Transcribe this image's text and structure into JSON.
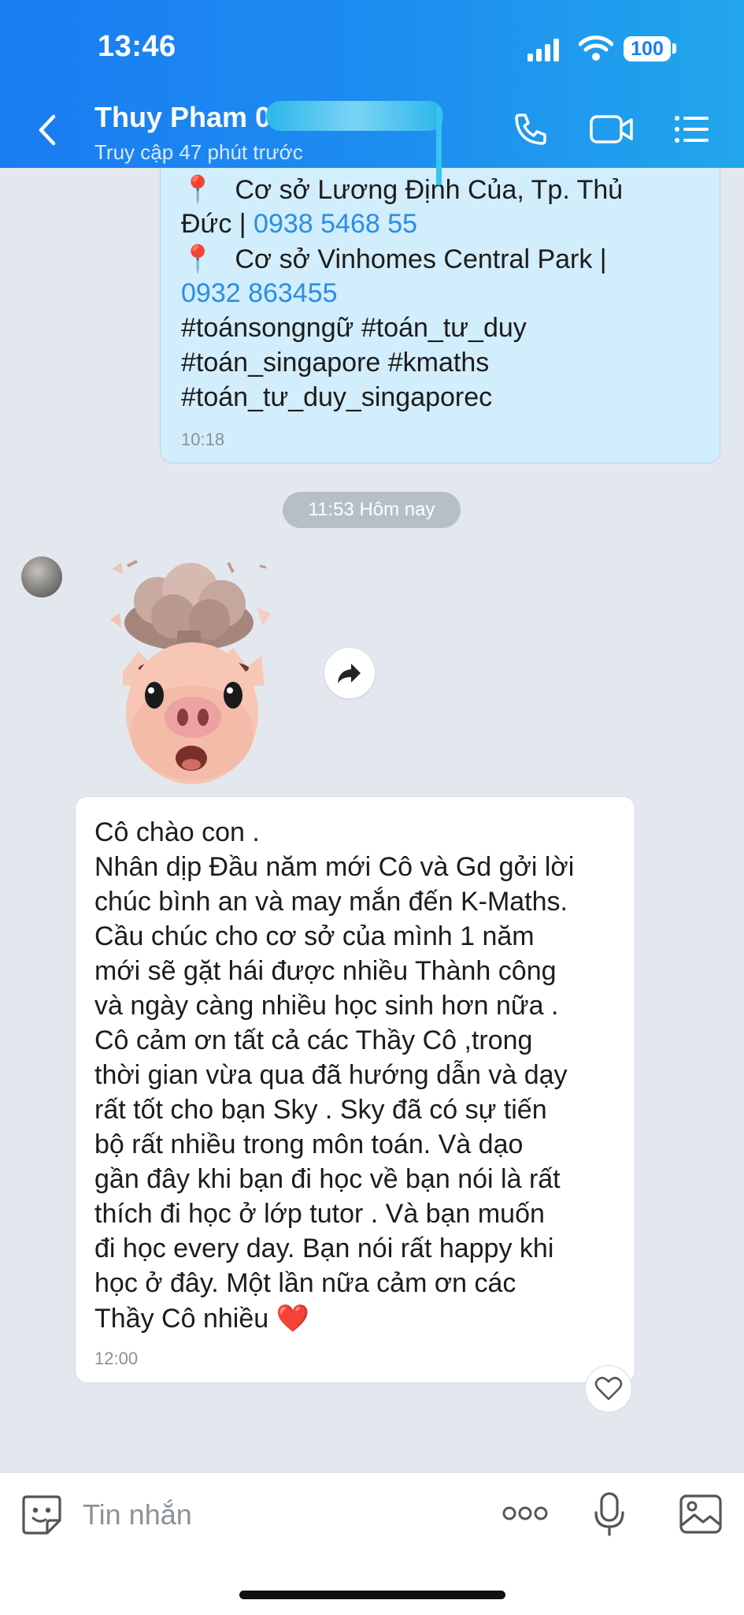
{
  "status_bar": {
    "time": "13:46",
    "battery": "100"
  },
  "header": {
    "contact_name": "Thuy Pham 0",
    "last_seen": "Truy cập 47 phút trước"
  },
  "outgoing_message": {
    "lines": [
      {
        "pin": true,
        "text": "Cơ sở Lương Định Của, Tp. Thủ"
      },
      {
        "text": "Đức | ",
        "phone": "0938 5468 55"
      },
      {
        "pin": true,
        "text": "Cơ sở Vinhomes Central Park  |"
      },
      {
        "phone": "0932 863455"
      },
      {
        "text": "#toánsongngữ #toán_tư_duy"
      },
      {
        "text": "#toán_singapore #kmaths"
      },
      {
        "text": "#toán_tư_duy_singaporec"
      }
    ],
    "time": "10:18"
  },
  "date_divider": "11:53 Hôm nay",
  "sticker": {
    "icon": "pig-mind-blown-sticker"
  },
  "incoming_message": {
    "lines": [
      "Cô chào con .",
      "Nhân dịp Đầu năm mới Cô và Gd gởi lời",
      "chúc bình an và may mắn đến K-Maths.",
      "Cầu chúc cho cơ sở của mình 1 năm",
      "mới sẽ gặt hái được nhiều Thành công",
      "và ngày càng nhiều học sinh hơn nữa .",
      "Cô cảm ơn tất cả các Thầy Cô ,trong",
      "thời gian vừa qua đã hướng dẫn và dạy",
      "rất tốt cho bạn Sky . Sky đã có sự tiến",
      "bộ rất nhiều trong môn toán. Và dạo",
      "gần đây khi bạn đi học về bạn nói là rất",
      "thích đi học ở lớp tutor . Và bạn muốn",
      "đi học every day. Bạn nói rất happy khi",
      "học ở đây. Một lần nữa cảm ơn các",
      "Thầy Cô nhiều ❤️"
    ],
    "time": "12:00"
  },
  "input": {
    "placeholder": "Tin nhắn"
  },
  "colors": {
    "header_start": "#1a7cf2",
    "header_end": "#22a6ec",
    "outgoing_bubble": "#d2edfb",
    "incoming_bubble": "#ffffff",
    "chat_background": "#e2e8ee",
    "link": "#2a8ee6"
  }
}
